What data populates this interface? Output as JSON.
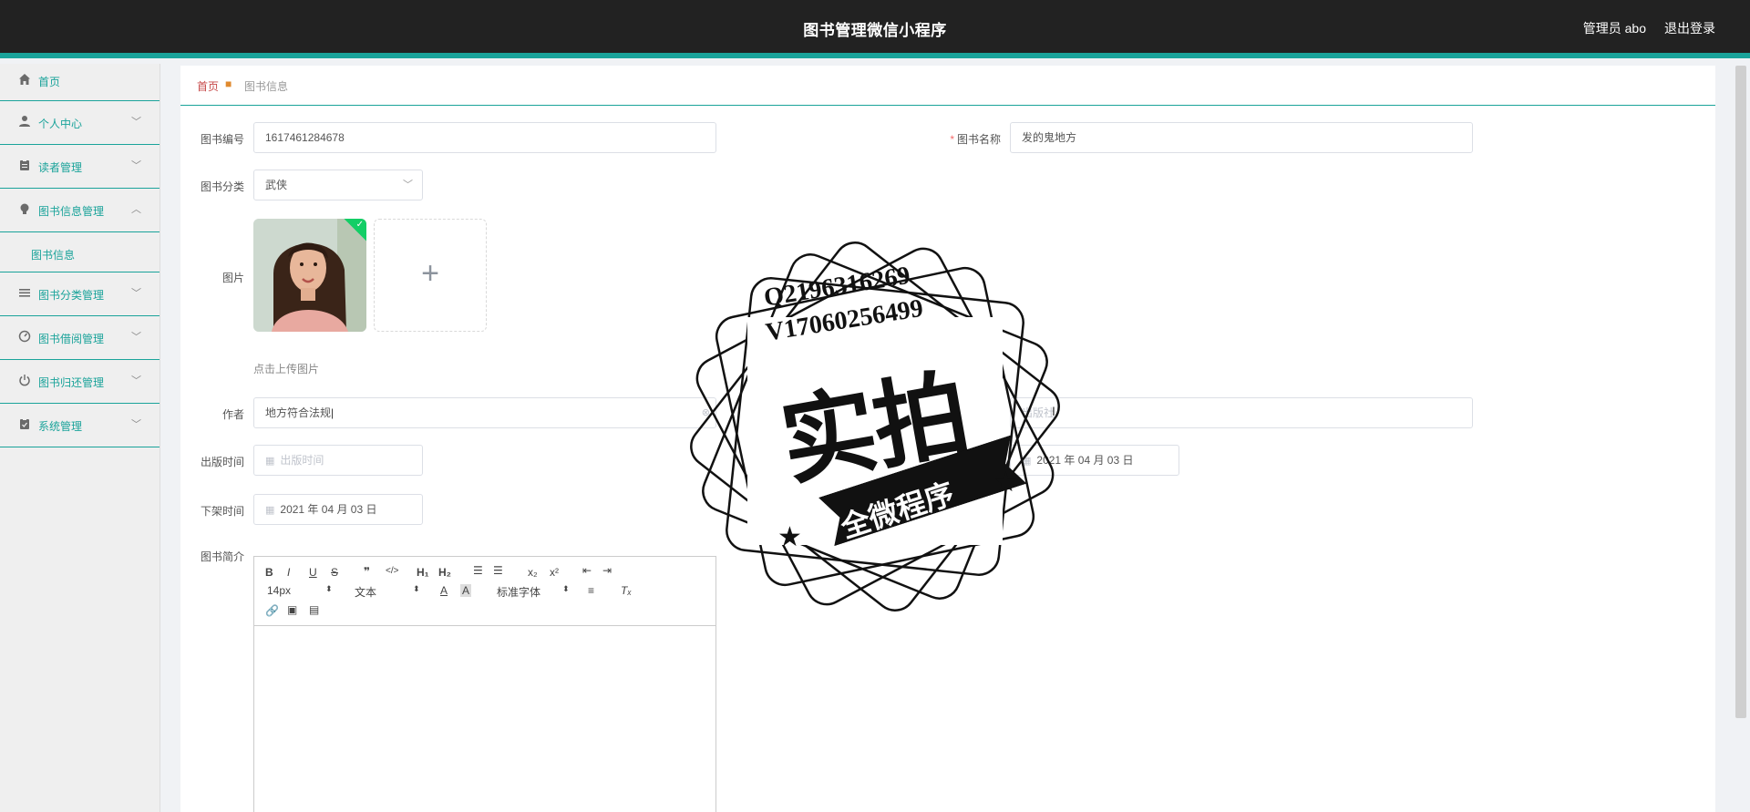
{
  "header": {
    "title": "图书管理微信小程序",
    "user": "管理员 abo",
    "logout": "退出登录"
  },
  "sidebar": {
    "items": [
      {
        "label": "首页",
        "icon": "home-icon"
      },
      {
        "label": "个人中心",
        "icon": "user-icon"
      },
      {
        "label": "读者管理",
        "icon": "clipboard-icon"
      },
      {
        "label": "图书信息管理",
        "icon": "bulb-icon"
      },
      {
        "label": "图书信息",
        "icon": ""
      },
      {
        "label": "图书分类管理",
        "icon": "list-icon"
      },
      {
        "label": "图书借阅管理",
        "icon": "dashboard-icon"
      },
      {
        "label": "图书归还管理",
        "icon": "power-icon"
      },
      {
        "label": "系统管理",
        "icon": "clipboard-icon"
      }
    ]
  },
  "breadcrumb": {
    "home": "首页",
    "current": "图书信息"
  },
  "form": {
    "book_no_label": "图书编号",
    "book_no_value": "1617461284678",
    "book_name_label": "图书名称",
    "book_name_value": "发的鬼地方",
    "category_label": "图书分类",
    "category_value": "武侠",
    "image_label": "图片",
    "upload_tip": "点击上传图片",
    "author_label": "作者",
    "author_value": "地方符合法规",
    "publisher_label": "社",
    "publisher_placeholder": "出版社",
    "publish_time_label": "出版时间",
    "publish_time_placeholder": "出版时间",
    "shelf_time_label": "上架时间",
    "shelf_time_value": "2021 年 04 月 03 日",
    "off_time_label": "下架时间",
    "off_time_value": "2021 年 04 月 03 日",
    "intro_label": "图书简介"
  },
  "editor": {
    "font_size": "14px",
    "format": "文本",
    "font_family": "标准字体"
  },
  "watermark": {
    "line1": "Q2196316269",
    "line2": "V17060256499",
    "big": "实拍",
    "ribbon": "全微程序"
  },
  "colors": {
    "accent": "#1aa39a",
    "header_bg": "#222222",
    "breadcrumb_home": "#c74a4a"
  }
}
